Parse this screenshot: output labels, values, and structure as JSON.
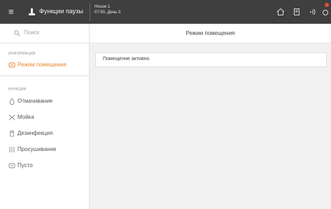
{
  "topbar": {
    "title": "Функции паузы",
    "house_name": "House 1",
    "house_sub": "07:50, День 0",
    "icons": [
      "menu-icon",
      "pause-functions-icon",
      "home-icon",
      "device-icon",
      "broadcast-icon",
      "notification-icon"
    ],
    "badge_color": "#e84c3d"
  },
  "sidebar": {
    "search_placeholder": "Поиск",
    "section_info": "ИНФОРМАЦИЯ",
    "info_items": [
      {
        "label": "Режим помещения",
        "icon": "room-mode-icon",
        "active": true
      }
    ],
    "section_functions": "ФУНКЦИИ",
    "function_items": [
      {
        "label": "Отмачивание",
        "icon": "soaking-icon"
      },
      {
        "label": "Мойка",
        "icon": "washing-icon"
      },
      {
        "label": "Дезинфекция",
        "icon": "disinfection-icon"
      },
      {
        "label": "Просушивание",
        "icon": "drying-icon"
      },
      {
        "label": "Пусто",
        "icon": "empty-icon"
      }
    ],
    "accent_color": "#e8862a"
  },
  "main": {
    "header_title": "Режим помещения",
    "status_text": "Помещение активно"
  }
}
